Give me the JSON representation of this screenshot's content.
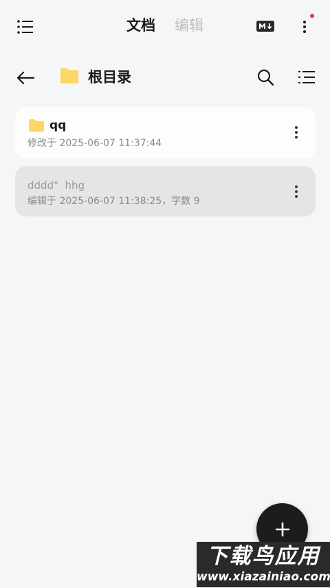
{
  "header": {
    "tabs": [
      {
        "label": "文档",
        "active": true
      },
      {
        "label": "编辑",
        "active": false
      }
    ],
    "markdown_icon_label": "M↓"
  },
  "path": {
    "title": "根目录"
  },
  "items": [
    {
      "type": "folder",
      "name": "qq",
      "meta": "修改于 2025-06-07 11:37:44"
    },
    {
      "type": "note",
      "title": "dddd\"  hhg",
      "meta": "编辑于 2025-06-07 11:38:25，字数 9"
    }
  ],
  "watermark": {
    "brand": "下载鸟应用",
    "url": "www.xiazainiao.com"
  },
  "colors": {
    "background": "#f5f6f8",
    "folder": "#fdd663",
    "accent_dot": "#e53935",
    "fab": "#1c1c1c"
  },
  "icons": [
    "menu-icon",
    "markdown-icon",
    "more-vertical-icon",
    "back-arrow-icon",
    "folder-icon",
    "search-icon",
    "list-icon",
    "plus-icon"
  ]
}
